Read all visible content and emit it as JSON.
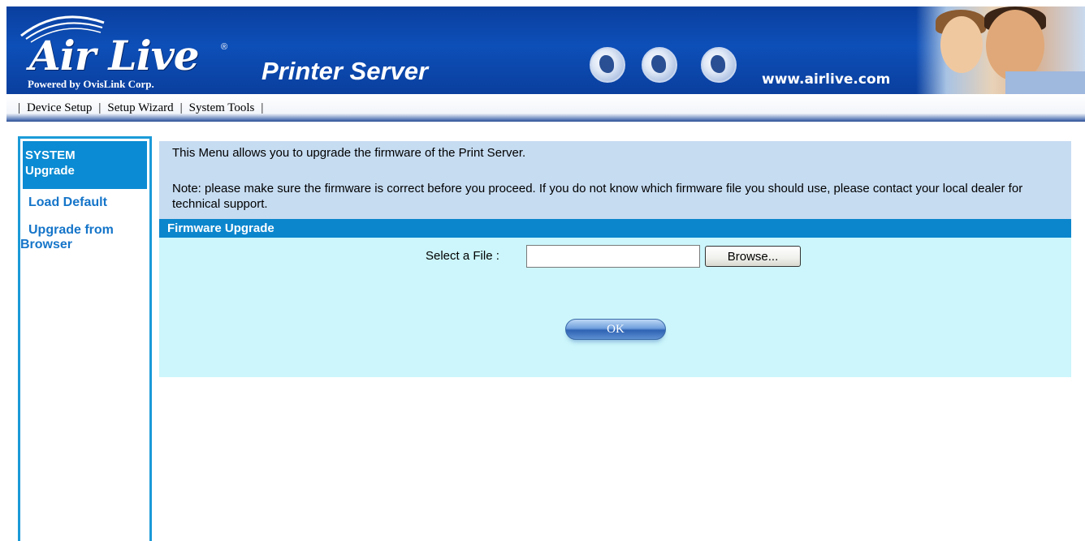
{
  "header": {
    "brand_name": "Air Live",
    "registered_mark": "®",
    "tagline": "Powered by OvisLink Corp.",
    "product_title": "Printer Server",
    "site_url": "www.airlive.com",
    "colors": {
      "banner": "#0d4fb8",
      "accent": "#0b8bd3",
      "panel": "#c6dcf1",
      "form_bg": "#ccf6fb"
    }
  },
  "topnav": {
    "separator": "|",
    "items": [
      {
        "label": "Device Setup"
      },
      {
        "label": "Setup Wizard"
      },
      {
        "label": "System Tools"
      }
    ]
  },
  "sidebar": {
    "heading_line1": "SYSTEM",
    "heading_line2": "Upgrade",
    "items": [
      {
        "label": "Load Default"
      },
      {
        "label_line1": "Upgrade from",
        "label_line2": "Browser"
      }
    ]
  },
  "main": {
    "info_text": "This Menu allows you to upgrade the firmware of the Print Server.",
    "note_text": "Note: please make sure the firmware is correct before you proceed. If you do not know which firmware file you should use, please contact your local dealer for technical support.",
    "section_title": "Firmware Upgrade",
    "file_label": "Select a File :",
    "file_value": "",
    "browse_label": "Browse...",
    "ok_label": "OK"
  },
  "icons": [
    "airlive-logo-swoosh-icon",
    "globe-icon",
    "globe-icon",
    "globe-icon"
  ]
}
